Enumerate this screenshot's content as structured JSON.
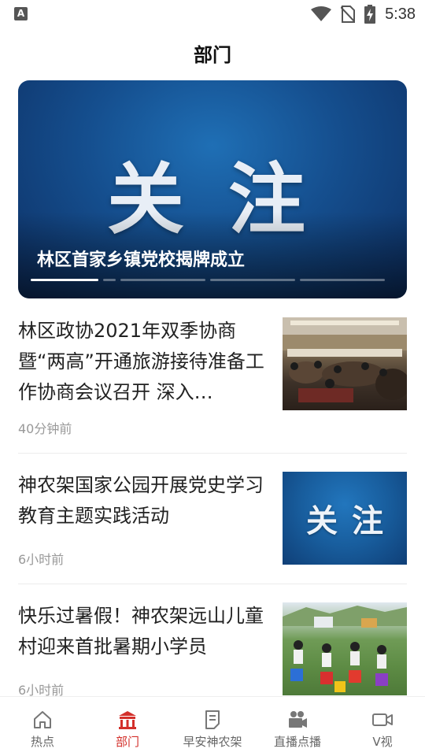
{
  "status_bar": {
    "left_icon": "A",
    "time": "5:38",
    "icons": [
      "wifi-icon",
      "no-sim-icon",
      "battery-charging-icon"
    ]
  },
  "header": {
    "title": "部门"
  },
  "banner": {
    "image_text": "关注",
    "caption": "林区首家乡镇党校揭牌成立",
    "slide_count": 5,
    "active_slide": 1
  },
  "news": [
    {
      "title": "林区政协2021年双季协商暨“两高”开通旅游接待准备工作协商会议召开 深入…",
      "time": "40分钟前",
      "thumb": "meeting-photo"
    },
    {
      "title": "神农架国家公园开展党史学习教育主题实践活动",
      "time": "6小时前",
      "thumb": "关注"
    },
    {
      "title": "快乐过暑假！神农架远山儿童村迎来首批暑期小学员",
      "time": "6小时前",
      "thumb": "outdoor-photo"
    }
  ],
  "bottom_nav": {
    "active": "部门",
    "accent_color": "#d3302b",
    "items": [
      {
        "label": "热点",
        "icon": "home-icon"
      },
      {
        "label": "部门",
        "icon": "building-icon"
      },
      {
        "label": "早安神农架",
        "icon": "document-icon"
      },
      {
        "label": "直播点播",
        "icon": "video-camera-icon"
      },
      {
        "label": "V视",
        "icon": "video-icon"
      }
    ]
  }
}
